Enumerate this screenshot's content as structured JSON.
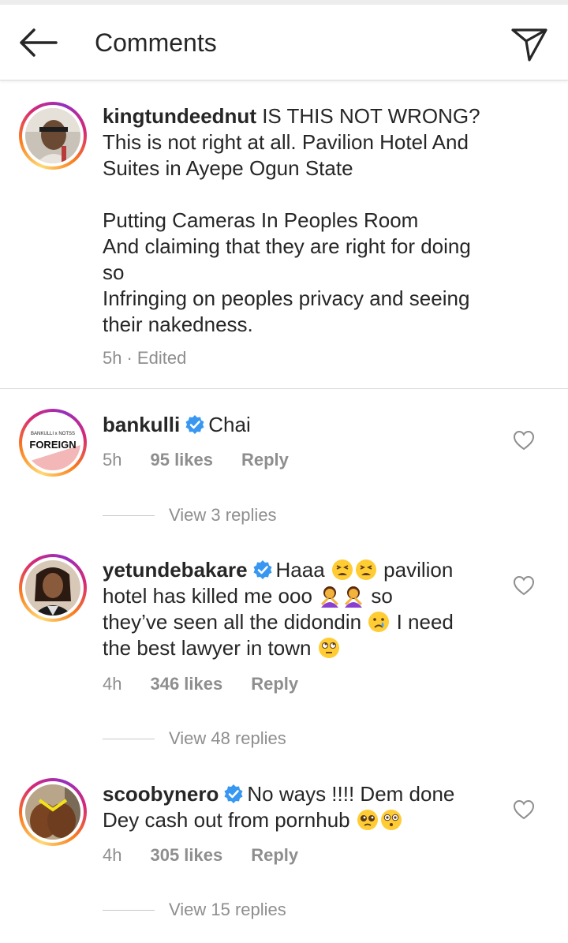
{
  "header": {
    "title": "Comments",
    "back_icon": "arrow-left-icon",
    "send_icon": "paper-plane-icon"
  },
  "caption": {
    "username": "kingtundeednut",
    "lines": [
      " IS THIS NOT WRONG?",
      "This is not right at all. Pavilion Hotel And",
      "Suites in Ayepe Ogun State",
      "",
      "Putting Cameras In Peoples Room",
      "And claiming that they are right for doing",
      "so",
      "Infringing on peoples privacy and seeing",
      "their nakedness."
    ],
    "time": "5h",
    "edited": "· Edited"
  },
  "comments": [
    {
      "username": "bankulli",
      "verified": true,
      "avatar_text": "FOREIGN",
      "avatar_small_text": "BANKULLI x NOTSS",
      "line1": "Chai",
      "time": "5h",
      "likes": "95 likes",
      "reply": "Reply",
      "view_replies": "View 3 replies"
    },
    {
      "username": "yetundebakare",
      "verified": true,
      "line1_a": "Haaa ",
      "line1_b": " pavilion",
      "line2_a": "hotel has killed me ooo ",
      "line2_b": " so",
      "line3_a": "they’ve seen all the didondin ",
      "line3_b": " I need",
      "line4_a": "the best lawyer in town ",
      "emojis": [
        "tired-face-emoji",
        "woman-gesturing-no-emoji",
        "crying-face-emoji",
        "eye-roll-emoji"
      ],
      "time": "4h",
      "likes": "346 likes",
      "reply": "Reply",
      "view_replies": "View 48 replies"
    },
    {
      "username": "scoobynero",
      "verified": true,
      "line1": "No ways !!!! Dem done",
      "line2_a": "Dey cash out from pornhub ",
      "emojis": [
        "pleading-face-emoji",
        "flushed-face-emoji"
      ],
      "time": "4h",
      "likes": "305 likes",
      "reply": "Reply",
      "view_replies": "View 15 replies"
    }
  ],
  "colors": {
    "text": "#262626",
    "meta": "#8e8e8e",
    "verified": "#3897f0",
    "divider": "#dbdbdb"
  }
}
